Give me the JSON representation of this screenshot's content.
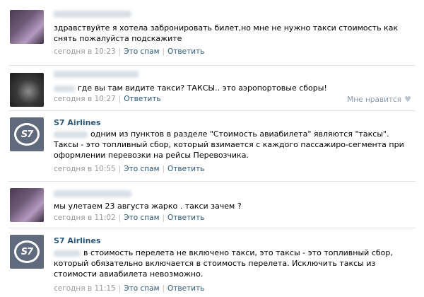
{
  "comments": [
    {
      "text": "здравствуйте я хотела забронировать билет,но мне не нужно такси стоимость как снять пожалуйста подскажите",
      "time": "сегодня в 10:23",
      "spam": "Это спам",
      "reply": "Ответить"
    },
    {
      "text": "где вы там видите такси? ТАКСЫ.. это аэропортовые сборы!",
      "time": "сегодня в 10:27",
      "reply": "Ответить",
      "like": "Мне нравится"
    },
    {
      "name": "S7 Airlines",
      "text": "одним из пунктов в разделе \"Стоимость авиабилета\" являются \"таксы\". Таксы - это топливный сбор, который взимается с каждого пассажиро-сегмента при оформлении перевозки на рейсы Перевозчика.",
      "time": "сегодня в 10:55",
      "spam": "Это спам",
      "reply": "Ответить"
    },
    {
      "text": "мы улетаем 23 августа жарко . такси зачем ?",
      "time": "сегодня в 11:02",
      "spam": "Это спам",
      "reply": "Ответить"
    },
    {
      "name": "S7 Airlines",
      "text": "в стоимость перелета не включено такси, это таксы - это топливный сбор, который обязательно включается в стоимость перелета. Исключить таксы из стоимости авиабилета невозможно.",
      "time": "сегодня в 11:15",
      "spam": "Это спам",
      "reply": "Ответить"
    }
  ],
  "logo_text": "S7",
  "colors": {
    "link": "#2b587a",
    "meta": "#999999",
    "separator": "#e1e6ea",
    "s7_bg": "#5f6a7c"
  }
}
